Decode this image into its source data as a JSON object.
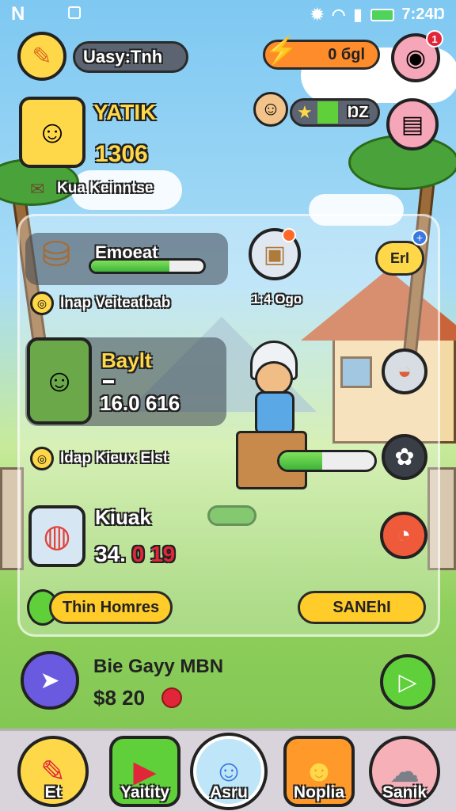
{
  "status_bar": {
    "left_letter": "N",
    "time": "7:24Ŋ"
  },
  "header": {
    "username": "Uasy:Tnh",
    "energy_value": "0 бgl",
    "notification_count": "1"
  },
  "profile": {
    "name": "YATIK",
    "score": "1306",
    "subtitle": "Kua Keinntse",
    "star_value": "ŊZ"
  },
  "tasks": [
    {
      "title": "Emoeat",
      "progress": 0.7,
      "caption": "Inap Veiteatbab"
    },
    {
      "title": "Baylt",
      "stat": "16.0 616",
      "caption": "Idap Kieux Elst"
    },
    {
      "title": "Kiuak",
      "stat_white": "34.",
      "stat_red": "0 19"
    }
  ],
  "side_items": {
    "chest_caption": "1:4 Ogo",
    "tag_label": "Erl"
  },
  "center_bar_progress": 0.45,
  "buttons": {
    "left_label": "Thin Homres",
    "right_label": "SANEhI"
  },
  "promo": {
    "title": "Bie Gayy MBN",
    "value": "$8 20"
  },
  "bottom_nav": [
    {
      "label": "Et"
    },
    {
      "label": "Yaitity"
    },
    {
      "label": "Asru"
    },
    {
      "label": "Noplia"
    },
    {
      "label": "Sanik"
    }
  ],
  "colors": {
    "accent_yellow": "#ffd84a",
    "accent_green": "#3fb43a",
    "accent_red": "#e2263a"
  }
}
